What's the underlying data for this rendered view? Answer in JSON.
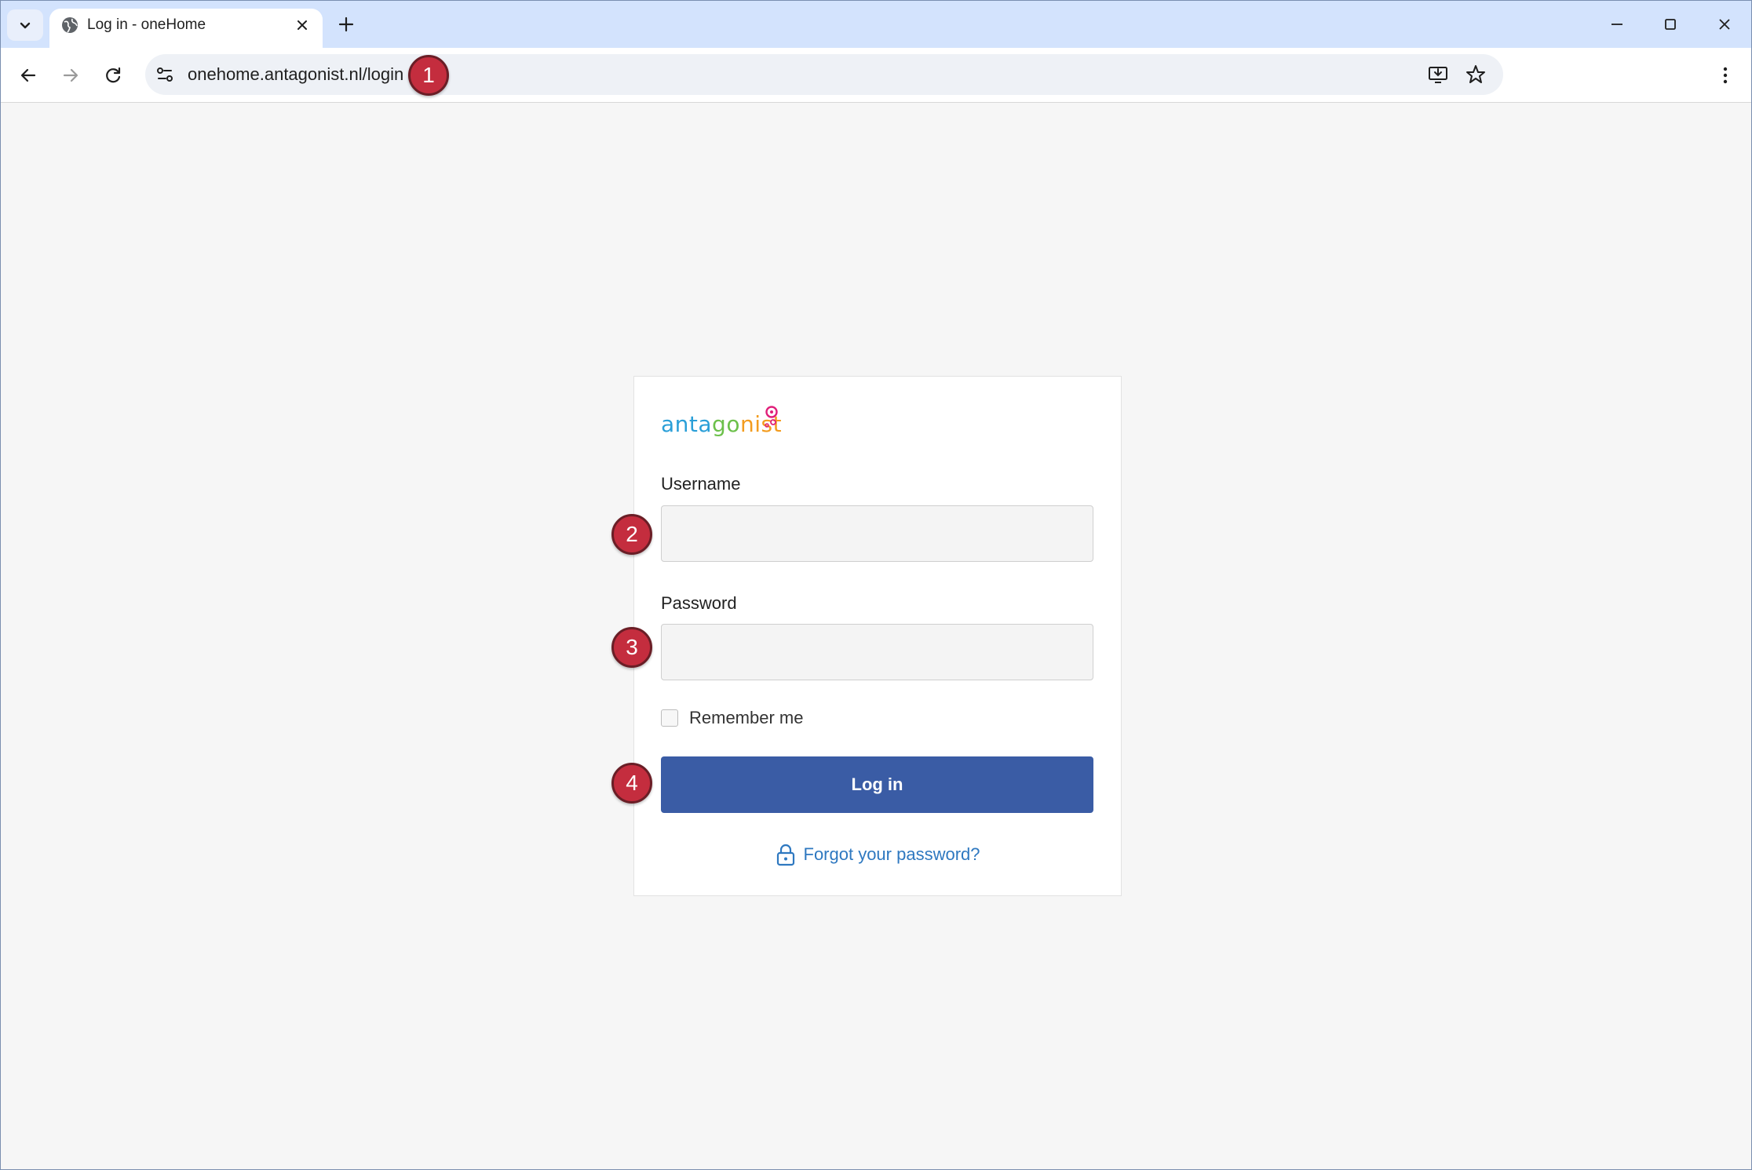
{
  "browser": {
    "tab_title": "Log in - oneHome",
    "url": "onehome.antagonist.nl/login"
  },
  "colors": {
    "primary_button": "#3a5ca5",
    "link": "#2e78c0",
    "marker": "#c42d3e",
    "logo_green": "#6cc04a",
    "logo_blue": "#2a9fd8",
    "logo_orange": "#f39c1f",
    "logo_pink": "#e0207a"
  },
  "logo": {
    "part1": "anta",
    "part2": "go",
    "part3": "nist"
  },
  "login": {
    "username_label": "Username",
    "username_value": "",
    "password_label": "Password",
    "password_value": "",
    "remember_label": "Remember me",
    "remember_checked": false,
    "submit_label": "Log in",
    "forgot_label": "Forgot your password?"
  },
  "annotations": {
    "m1": "1",
    "m2": "2",
    "m3": "3",
    "m4": "4"
  },
  "icons": {
    "tab_search": "chevron-down-icon",
    "favicon": "globe-icon",
    "tab_close": "close-icon",
    "new_tab": "plus-icon",
    "minimize": "minimize-icon",
    "maximize": "maximize-icon",
    "close": "close-icon",
    "back": "arrow-left-icon",
    "forward": "arrow-right-icon",
    "reload": "reload-icon",
    "site_info": "site-settings-icon",
    "install": "install-app-icon",
    "bookmark": "star-icon",
    "menu": "kebab-menu-icon",
    "forgot": "lock-icon"
  }
}
